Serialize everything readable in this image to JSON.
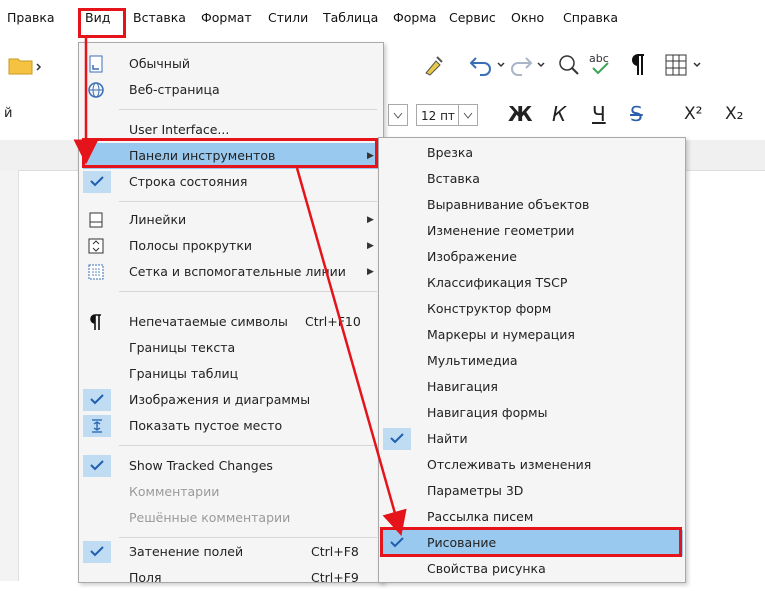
{
  "menubar": {
    "items": [
      "Правка",
      "Вид",
      "Вставка",
      "Формат",
      "Стили",
      "Таблица",
      "Форма",
      "Сервис",
      "Окно",
      "Справка"
    ]
  },
  "format_bar": {
    "font_name_partial": "й",
    "font_size": "12 пт",
    "bold": "Ж",
    "italic": "К",
    "underline": "Ч",
    "strike": "S",
    "superscript": "X²",
    "subscript": "X₂"
  },
  "view_menu": {
    "items": [
      {
        "label": "Обычный"
      },
      {
        "label": "Веб-страница"
      },
      {
        "label": "User Interface..."
      },
      {
        "label": "Панели инструментов"
      },
      {
        "label": "Строка состояния"
      },
      {
        "label": "Линейки"
      },
      {
        "label": "Полосы прокрутки"
      },
      {
        "label": "Сетка и вспомогательные линии"
      },
      {
        "label": "Непечатаемые символы",
        "shortcut": "Ctrl+F10"
      },
      {
        "label": "Границы текста"
      },
      {
        "label": "Границы таблиц"
      },
      {
        "label": "Изображения и диаграммы"
      },
      {
        "label": "Показать пустое место"
      },
      {
        "label": "Show Tracked Changes"
      },
      {
        "label": "Комментарии"
      },
      {
        "label": "Решённые комментарии"
      },
      {
        "label": "Затенение полей",
        "shortcut": "Ctrl+F8"
      },
      {
        "label": "Поля",
        "shortcut": "Ctrl+F9"
      }
    ]
  },
  "toolbars_submenu": {
    "items": [
      {
        "label": "Врезка"
      },
      {
        "label": "Вставка"
      },
      {
        "label": "Выравнивание объектов"
      },
      {
        "label": "Изменение геометрии"
      },
      {
        "label": "Изображение"
      },
      {
        "label": "Классификация TSCP"
      },
      {
        "label": "Конструктор форм"
      },
      {
        "label": "Маркеры и нумерация"
      },
      {
        "label": "Мультимедиа"
      },
      {
        "label": "Навигация"
      },
      {
        "label": "Навигация формы"
      },
      {
        "label": "Найти"
      },
      {
        "label": "Отслеживать изменения"
      },
      {
        "label": "Параметры 3D"
      },
      {
        "label": "Рассылка писем"
      },
      {
        "label": "Рисование"
      },
      {
        "label": "Свойства рисунка"
      }
    ]
  },
  "colors": {
    "highlight": "#99c9ef",
    "check_bg": "#bfdcf3",
    "annotation_red": "#e5141b"
  }
}
